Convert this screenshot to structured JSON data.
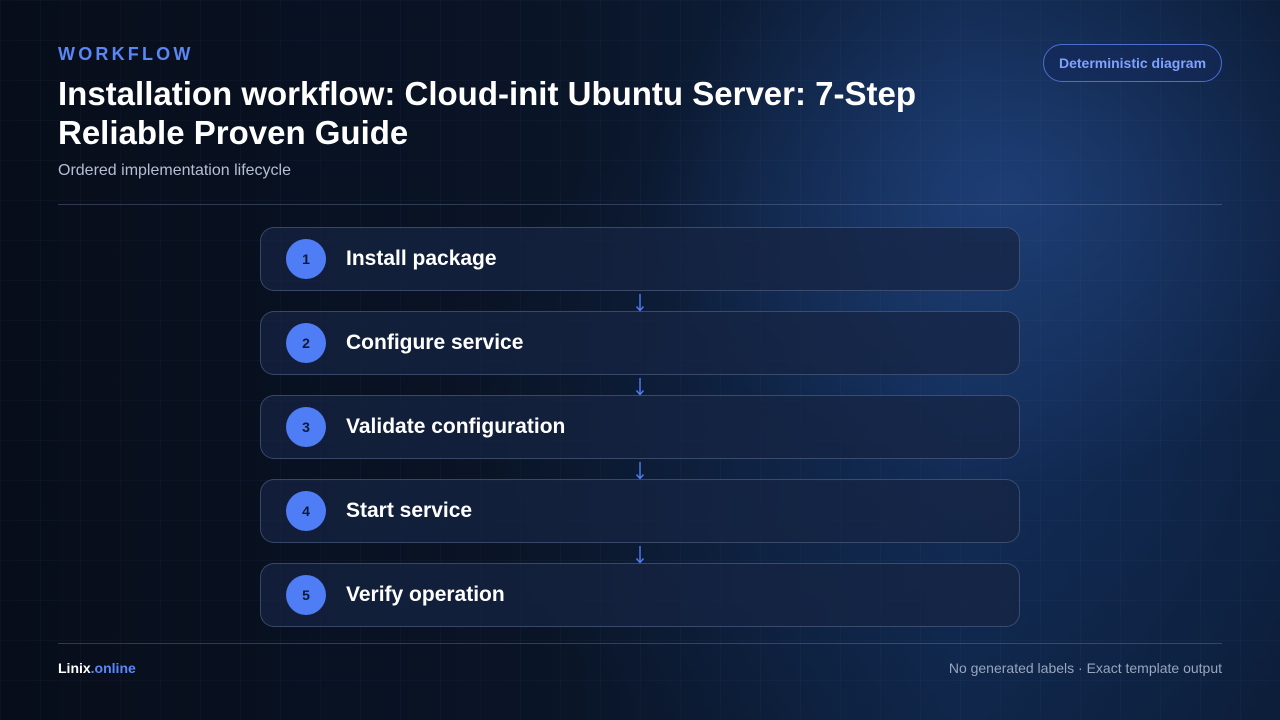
{
  "header": {
    "eyebrow": "WORKFLOW",
    "title": "Installation workflow: Cloud-init Ubuntu Server: 7-Step Reliable Proven Guide",
    "subtitle": "Ordered implementation lifecycle",
    "badge": "Deterministic diagram"
  },
  "steps": [
    {
      "number": "1",
      "label": "Install package"
    },
    {
      "number": "2",
      "label": "Configure service"
    },
    {
      "number": "3",
      "label": "Validate configuration"
    },
    {
      "number": "4",
      "label": "Start service"
    },
    {
      "number": "5",
      "label": "Verify operation"
    }
  ],
  "footer": {
    "brand_name": "Linix",
    "brand_suffix": ".online",
    "note": "No generated labels · Exact template output"
  },
  "colors": {
    "accent": "#5b86f5",
    "step_circle": "#4f7df6",
    "arrow": "#4f7df6"
  },
  "icons": {
    "connector": "arrow-down-icon"
  }
}
